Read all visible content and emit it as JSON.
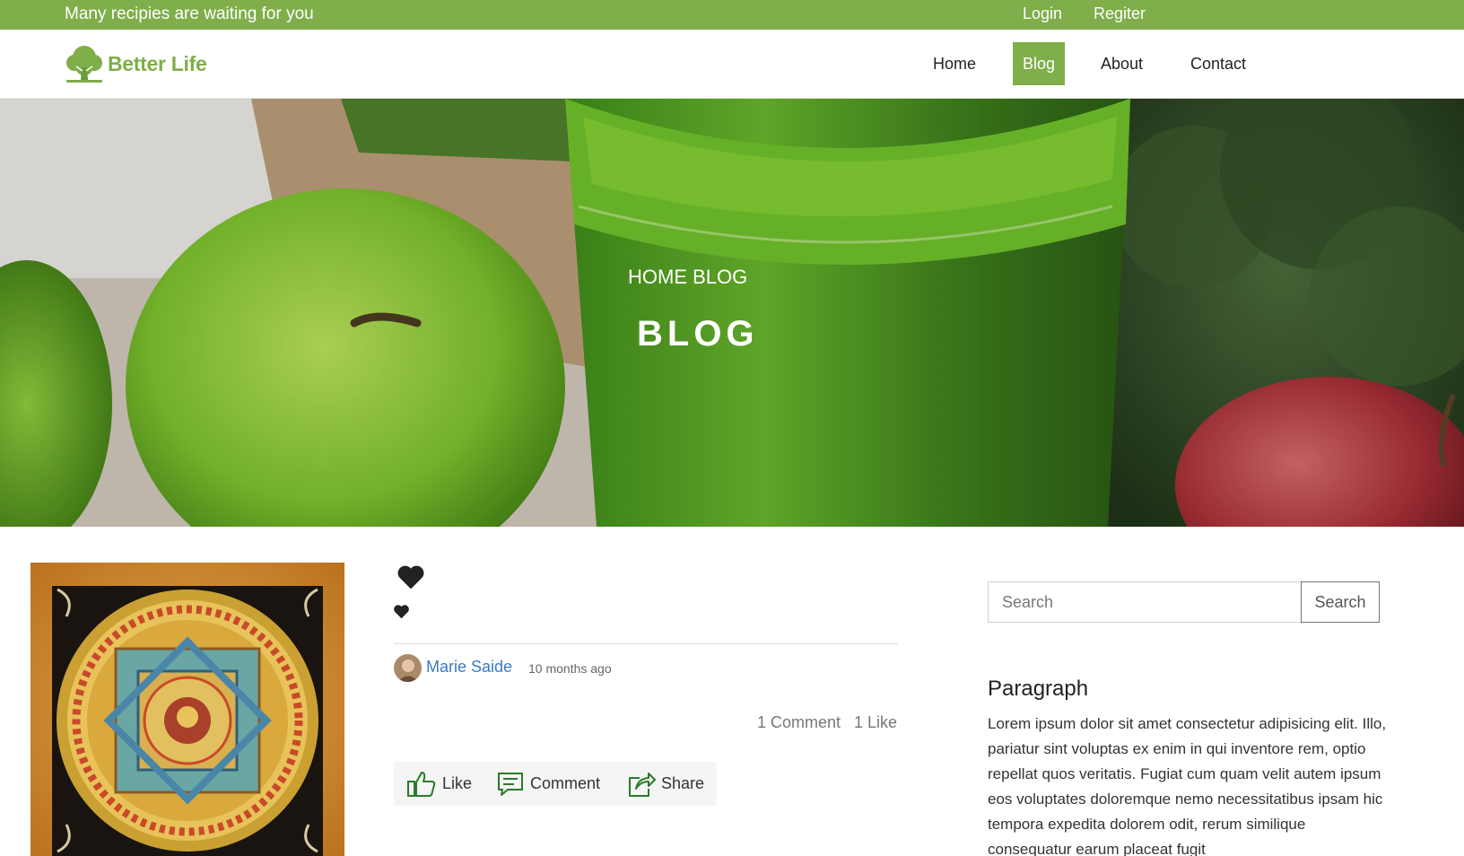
{
  "topbar": {
    "tagline": "Many recipies are waiting for you",
    "login": "Login",
    "register": "Regiter"
  },
  "brand": {
    "name": "Better Life",
    "logo_icon": "tree-icon"
  },
  "nav": {
    "items": [
      {
        "label": "Home",
        "active": false
      },
      {
        "label": "Blog",
        "active": true
      },
      {
        "label": "About",
        "active": false
      },
      {
        "label": "Contact",
        "active": false
      }
    ]
  },
  "hero": {
    "breadcrumb": "HOME BLOG",
    "title": "BLOG"
  },
  "post": {
    "image_subject": "mandala-painting",
    "author": "Marie Saide",
    "time": "10 months ago",
    "comments_count": "1 Comment",
    "likes_count": "1 Like",
    "actions": {
      "like": "Like",
      "comment": "Comment",
      "share": "Share"
    }
  },
  "sidebar": {
    "search_placeholder": "Search",
    "search_button": "Search",
    "paragraph_heading": "Paragraph",
    "paragraph_text": "Lorem ipsum dolor sit amet consectetur adipisicing elit. Illo, pariatur sint voluptas ex enim in qui inventore rem, optio repellat quos veritatis. Fugiat cum quam velit autem ipsum eos voluptates doloremque nemo necessitatibus ipsam hic tempora expedita dolorem odit, rerum similique consequatur earum placeat fugit"
  },
  "colors": {
    "brand_green": "#7fae4a",
    "link_blue": "#3a7ac4"
  }
}
